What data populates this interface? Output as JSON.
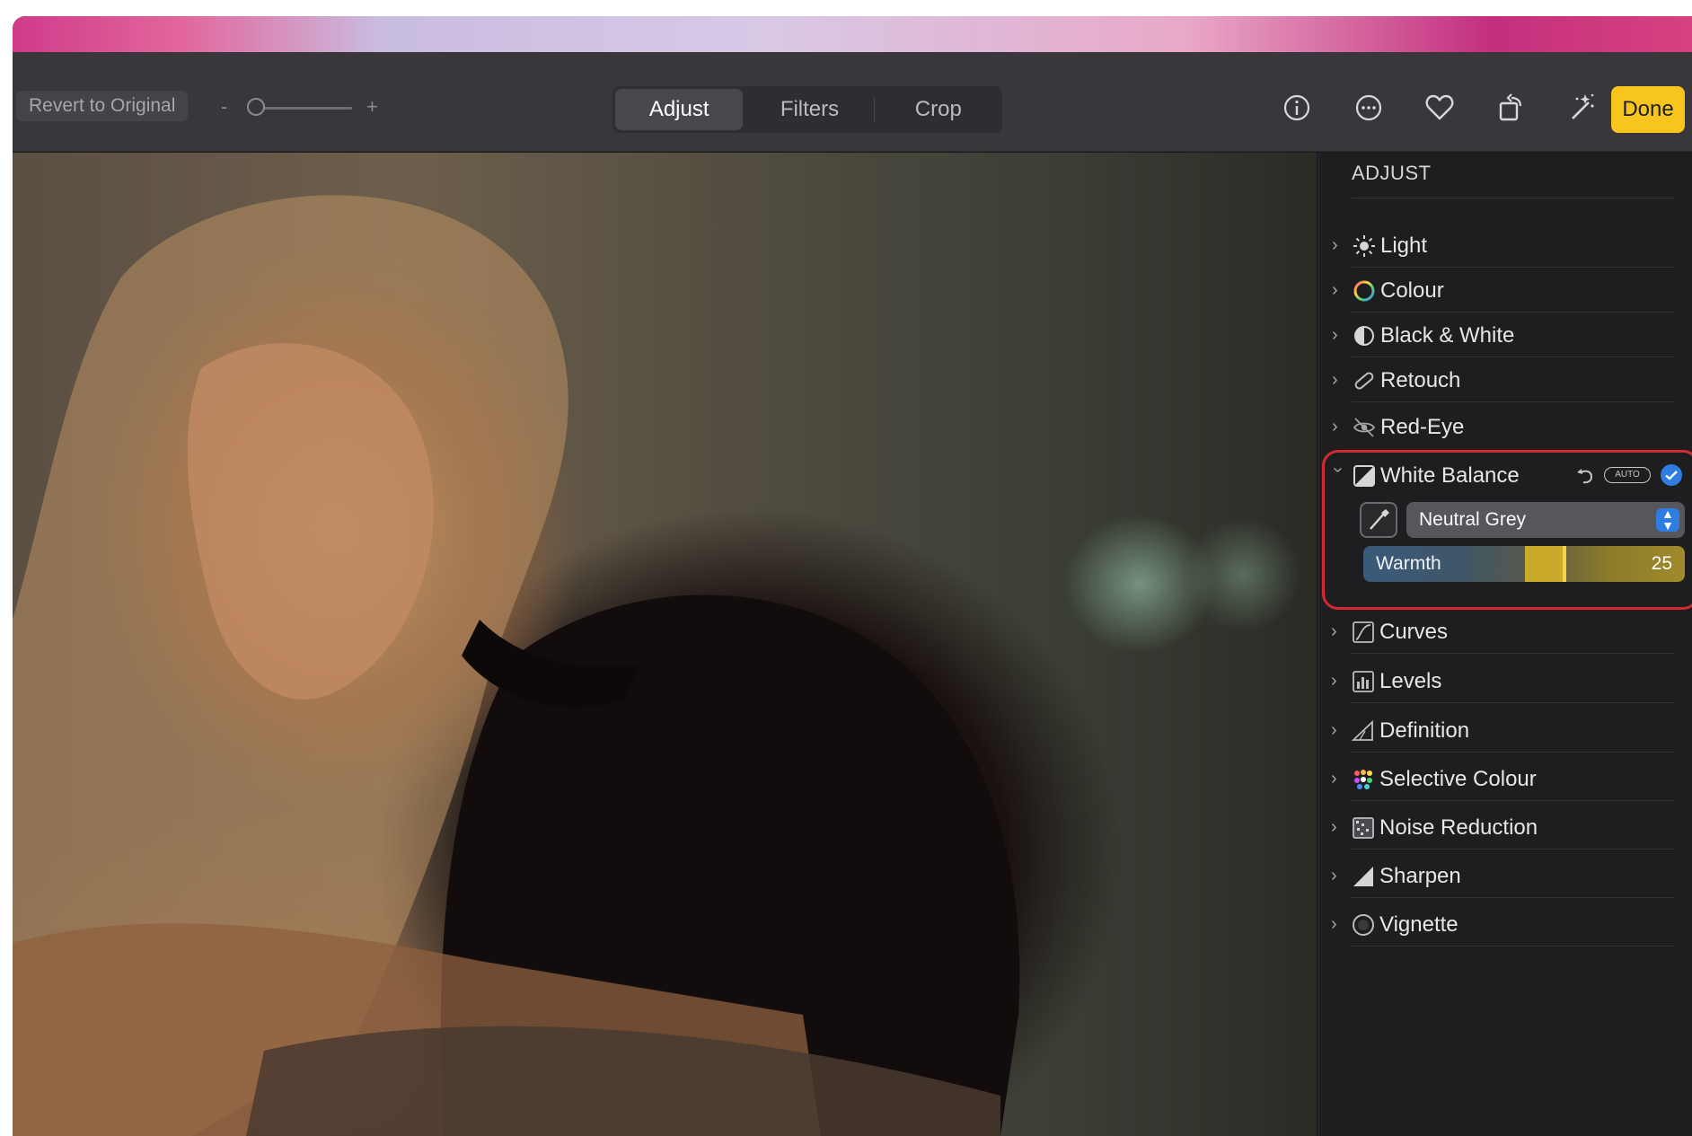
{
  "toolbar": {
    "revert_label": "Revert to Original",
    "zoom_minus": "-",
    "zoom_plus": "+",
    "tabs": [
      "Adjust",
      "Filters",
      "Crop"
    ],
    "active_tab": "Adjust",
    "icons": [
      "info-icon",
      "more-options-icon",
      "heart-icon",
      "rotate-icon",
      "magic-wand-icon"
    ],
    "done_label": "Done",
    "accent_color": "#f7c51e"
  },
  "photo": {
    "description_icon": "photo-image"
  },
  "sidebar": {
    "header": "ADJUST",
    "items": [
      {
        "label": "Light",
        "icon": "sun-icon",
        "expanded": false
      },
      {
        "label": "Colour",
        "icon": "colour-circle-icon",
        "expanded": false
      },
      {
        "label": "Black & White",
        "icon": "half-circle-icon",
        "expanded": false
      },
      {
        "label": "Retouch",
        "icon": "bandage-icon",
        "expanded": false
      },
      {
        "label": "Red-Eye",
        "icon": "eye-icon",
        "expanded": false
      },
      {
        "label": "White Balance",
        "icon": "white-balance-icon",
        "expanded": true
      },
      {
        "label": "Curves",
        "icon": "curves-icon",
        "expanded": false
      },
      {
        "label": "Levels",
        "icon": "levels-icon",
        "expanded": false
      },
      {
        "label": "Definition",
        "icon": "definition-icon",
        "expanded": false
      },
      {
        "label": "Selective Colour",
        "icon": "selective-colour-icon",
        "expanded": false
      },
      {
        "label": "Noise Reduction",
        "icon": "noise-reduction-icon",
        "expanded": false
      },
      {
        "label": "Sharpen",
        "icon": "sharpen-icon",
        "expanded": false
      },
      {
        "label": "Vignette",
        "icon": "vignette-icon",
        "expanded": false
      }
    ],
    "white_balance": {
      "auto_label": "AUTO",
      "preset": "Neutral Grey",
      "slider_label": "Warmth",
      "slider_value": "25",
      "highlight_color": "#d22a33",
      "checkmark_color": "#2f7de0"
    }
  }
}
